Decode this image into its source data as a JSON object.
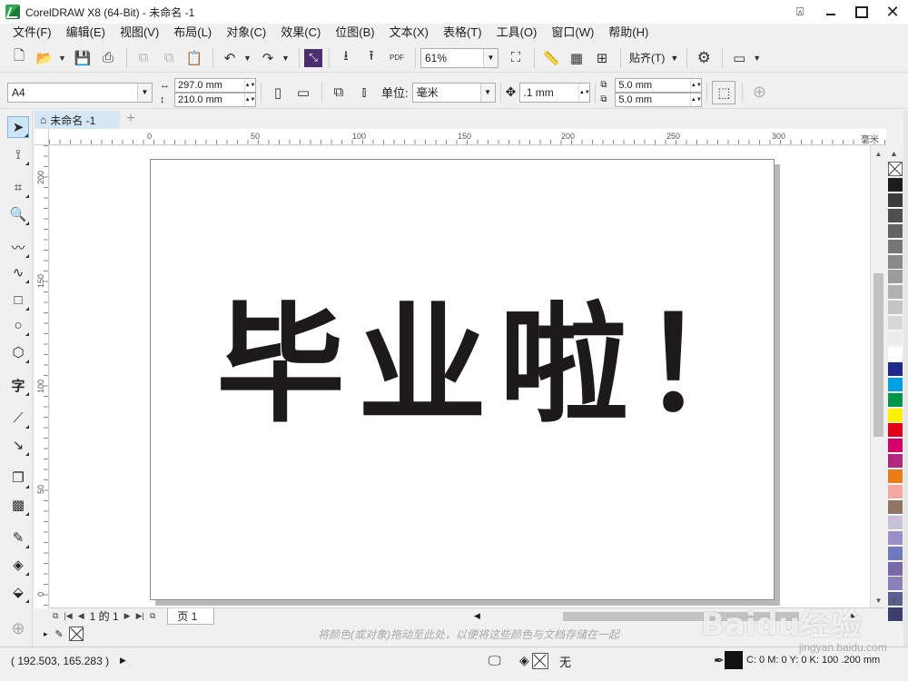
{
  "window": {
    "title": "CorelDRAW X8 (64-Bit) - 未命名 -1"
  },
  "menu": [
    "文件(F)",
    "编辑(E)",
    "视图(V)",
    "布局(L)",
    "对象(C)",
    "效果(C)",
    "位图(B)",
    "文本(X)",
    "表格(T)",
    "工具(O)",
    "窗口(W)",
    "帮助(H)"
  ],
  "toolbar": {
    "zoom_value": "61%",
    "snap_label": "贴齐(T)",
    "pdf_label": "PDF"
  },
  "propbar": {
    "page_size": "A4",
    "width": "297.0 mm",
    "height": "210.0 mm",
    "unit_label": "单位:",
    "unit_value": "毫米",
    "nudge": ".1 mm",
    "dup_x": "5.0 mm",
    "dup_y": "5.0 mm"
  },
  "document": {
    "tab_name": "未命名 -1",
    "page_text": "毕业啦！",
    "page_indicator": "1 的 1",
    "page_tab": "页 1"
  },
  "rulers": {
    "unit": "毫米",
    "h_ticks": [
      "0",
      "50",
      "100",
      "150",
      "200",
      "250",
      "300"
    ],
    "v_ticks": [
      "200",
      "150",
      "100",
      "50",
      "0"
    ]
  },
  "palette": {
    "colors": [
      "#1e1b1b",
      "#3c3c3c",
      "#4f4f4f",
      "#626262",
      "#767676",
      "#898989",
      "#9c9c9c",
      "#b0b0b0",
      "#c4c4c4",
      "#d8d8d8",
      "#ececec",
      "#ffffff",
      "#1f2a8c",
      "#00a0e0",
      "#00954a",
      "#fff100",
      "#e2001a",
      "#d4006a",
      "#b2277e",
      "#e97e19",
      "#f4a7a0",
      "#8e7565",
      "#c9c1d8",
      "#9c8fc7",
      "#6f7bbf",
      "#7a69aa",
      "#8b80b7",
      "#5a5f93",
      "#3e3e6e"
    ]
  },
  "colorbar": {
    "hint": "将颜色(或对象)拖动至此处，以便将这些颜色与文档存储在一起"
  },
  "status": {
    "coords": "( 192.503, 165.283 )",
    "fill_label": "无",
    "outline": "C: 0 M: 0 Y: 0 K: 100  .200 mm"
  },
  "watermark": {
    "text": "Baidu经验",
    "sub": "jingyan.baidu.com"
  }
}
